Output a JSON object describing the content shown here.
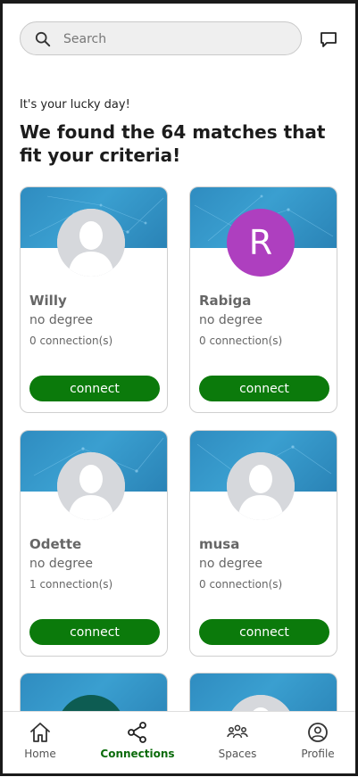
{
  "search": {
    "placeholder": "Search"
  },
  "header": {
    "subtitle": "It's your lucky day!",
    "headline": "We found the 64 matches that fit your criteria!"
  },
  "cards": [
    {
      "name": "Willy",
      "degree": "no degree",
      "connections": "0 connection(s)",
      "button": "connect",
      "avatar": "default-avatar-icon"
    },
    {
      "name": "Rabiga",
      "degree": "no degree",
      "connections": "0 connection(s)",
      "button": "connect",
      "avatar_letter": "R",
      "avatar_color": "#ae3fbf"
    },
    {
      "name": "Odette",
      "degree": "no degree",
      "connections": "1 connection(s)",
      "button": "connect",
      "avatar": "default-avatar-icon"
    },
    {
      "name": "musa",
      "degree": "no degree",
      "connections": "0 connection(s)",
      "button": "connect",
      "avatar": "default-avatar-icon"
    }
  ],
  "nav": {
    "items": [
      {
        "label": "Home",
        "icon": "home-icon"
      },
      {
        "label": "Connections",
        "icon": "connections-icon",
        "active": true
      },
      {
        "label": "Spaces",
        "icon": "spaces-icon"
      },
      {
        "label": "Profile",
        "icon": "profile-icon"
      }
    ]
  },
  "colors": {
    "accent": "#0b7a0b",
    "banner": "#3a9fd0",
    "avatar_r": "#ae3fbf"
  }
}
